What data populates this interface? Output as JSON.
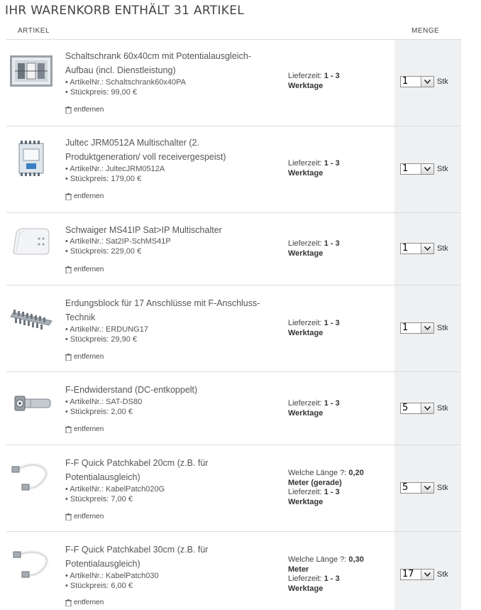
{
  "header": {
    "title": "IHR WARENKORB ENTHÄLT 31 ARTIKEL"
  },
  "columns": {
    "artikel": "ARTIKEL",
    "menge": "MENGE"
  },
  "labels": {
    "artikel_nr": "• ArtikelNr.: ",
    "stueckpreis": "• Stückpreis: ",
    "remove": "entfernen",
    "lieferzeit": "Lieferzeit: ",
    "lieferzeit_value": "1 - 3",
    "werktage": "Werktage",
    "laenge": "Welche Länge ?: ",
    "unit": "Stk"
  },
  "items": [
    {
      "name_lines": [
        "Schaltschrank 60x40cm mit Potentialausgleich-",
        "Aufbau (incl. Dienstleistung)"
      ],
      "artikel_nr": "Schaltschrank60x40PA",
      "price": "99,00 €",
      "qty": "1",
      "icon": "cabinet-icon"
    },
    {
      "name_lines": [
        "Jultec JRM0512A Multischalter (2.",
        "Produktgeneration/ voll receivergespeist)"
      ],
      "artikel_nr": "JultecJRM0512A",
      "price": "179,00 €",
      "qty": "1",
      "icon": "multiswitch-icon"
    },
    {
      "name_lines": [
        "Schwaiger MS41IP Sat>IP Multischalter"
      ],
      "artikel_nr": "Sat2IP-SchMS41P",
      "price": "229,00 €",
      "qty": "1",
      "icon": "satip-device-icon"
    },
    {
      "name_lines": [
        "Erdungsblock für 17 Anschlüsse mit F-Anschluss-",
        "Technik"
      ],
      "artikel_nr": "ERDUNG17",
      "price": "29,90 €",
      "qty": "1",
      "icon": "grounding-block-icon"
    },
    {
      "name_lines": [
        "F-Endwiderstand (DC-entkoppelt)"
      ],
      "artikel_nr": "SAT-DS80",
      "price": "2,00 €",
      "qty": "5",
      "icon": "terminator-icon"
    },
    {
      "name_lines": [
        "F-F Quick Patchkabel 20cm (z.B. für",
        "Potentialausgleich)"
      ],
      "artikel_nr": "KabelPatch020G",
      "price": "7,00 €",
      "qty": "5",
      "laenge": "0,20",
      "laenge_unit": "Meter (gerade)",
      "icon": "patch-cable-icon"
    },
    {
      "name_lines": [
        "F-F Quick Patchkabel 30cm (z.B. für",
        "Potentialausgleich)"
      ],
      "artikel_nr": "KabelPatch030",
      "price": "6,00 €",
      "qty": "17",
      "laenge": "0,30",
      "laenge_unit": "Meter",
      "icon": "patch-cable-icon"
    }
  ]
}
